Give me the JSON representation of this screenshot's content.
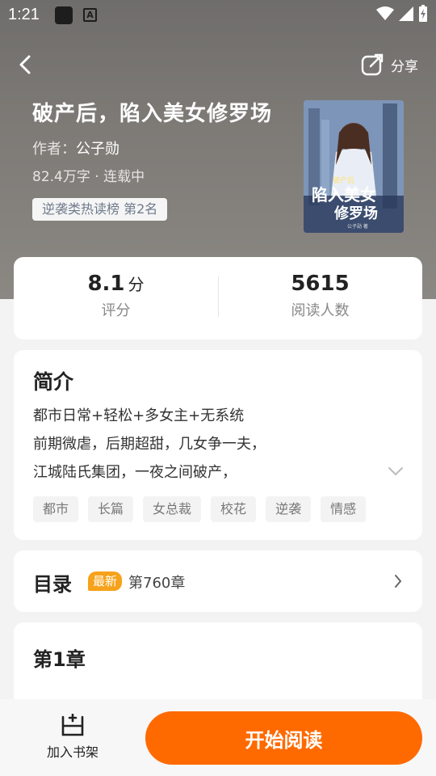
{
  "status_bar": {
    "time": "1:21",
    "a_glyph": "A"
  },
  "header": {
    "share_label": "分享"
  },
  "book": {
    "title": "破产后，陷入美女修罗场",
    "author_label": "作者：",
    "author_name": "公子勋",
    "meta": "82.4万字 · 连载中",
    "rank": "逆袭类热读榜  第2名",
    "cover_text_top": "破产后",
    "cover_text_main": "陷入美女",
    "cover_text_sub": "修罗场",
    "cover_author": "公子勋 著"
  },
  "stats": {
    "score": "8.1",
    "score_unit": "分",
    "score_label": "评分",
    "readers": "5615",
    "readers_label": "阅读人数"
  },
  "intro": {
    "heading": "简介",
    "lines": [
      "都市日常+轻松+多女主+无系统",
      "前期微虐，后期超甜，几女争一夫，",
      "江城陆氏集团，一夜之间破产，"
    ],
    "tags": [
      "都市",
      "长篇",
      "女总裁",
      "校花",
      "逆袭",
      "情感"
    ]
  },
  "toc": {
    "heading": "目录",
    "badge": "最新",
    "latest": "第760章"
  },
  "chapter": {
    "heading": "第1章"
  },
  "bottom": {
    "shelf_label": "加入书架",
    "read_button": "开始阅读"
  },
  "colors": {
    "accent": "#ff6a00",
    "badge": "#f6a21a"
  }
}
